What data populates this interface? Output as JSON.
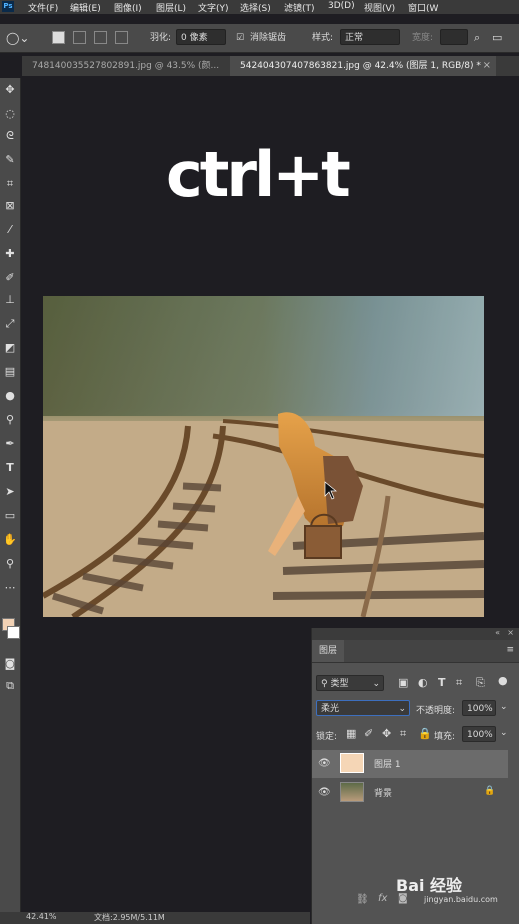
{
  "menubar": {
    "items": [
      "文件(F)",
      "编辑(E)",
      "图像(I)",
      "图层(L)",
      "文字(Y)",
      "选择(S)",
      "滤镜(T)",
      "3D(D)",
      "视图(V)",
      "窗口(W"
    ]
  },
  "options": {
    "feather_label": "羽化:",
    "feather_value": "0 像素",
    "antialias_label": "消除锯齿",
    "style_label": "样式:",
    "style_value": "正常",
    "width_label": "宽度:"
  },
  "tabs": [
    {
      "label": "748140035527802891.jpg @ 43.5% (颜..."
    },
    {
      "label": "542404307407863821.jpg @ 42.4% (图层 1, RGB/8) *"
    }
  ],
  "canvas": {
    "overlay_text": "ctrl+t"
  },
  "layers_panel": {
    "title": "图层",
    "filter_type": "类型",
    "blend_mode": "柔光",
    "opacity_label": "不透明度:",
    "opacity_value": "100%",
    "lock_label": "锁定:",
    "fill_label": "填充:",
    "fill_value": "100%",
    "layers": [
      {
        "name": "图层 1"
      },
      {
        "name": "背景"
      }
    ]
  },
  "status": {
    "zoom": "42.41%",
    "doc": "文档:2.95M/5.11M"
  },
  "watermark": {
    "brand": "Bai 经验",
    "url": "jingyan.baidu.com"
  }
}
